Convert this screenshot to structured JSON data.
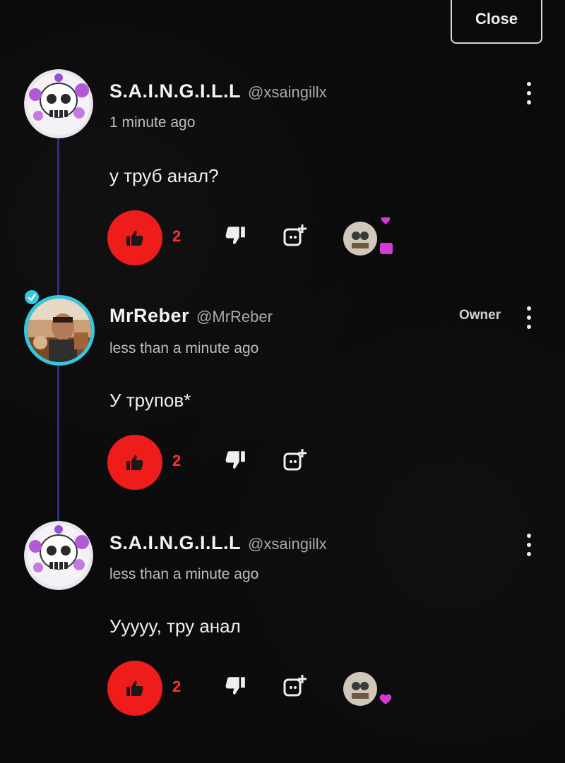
{
  "close_label": "Close",
  "owner_label": "Owner",
  "comments": [
    {
      "author": "S.A.I.N.G.I.L.L",
      "handle": "@xsaingillx",
      "time": "1 minute ago",
      "text": "у труб анал?",
      "likes": "2",
      "avatar_icon": "skull-avatar-icon",
      "has_creator_heart": true
    },
    {
      "author": "MrReber",
      "handle": "@MrReber",
      "time": "less than a minute ago",
      "text": "У трупов*",
      "likes": "2",
      "avatar_icon": "photo-avatar-icon",
      "is_owner": true,
      "has_creator_heart": false
    },
    {
      "author": "S.A.I.N.G.I.L.L",
      "handle": "@xsaingillx",
      "time": "less than a minute ago",
      "text": "Уyyyy, тру анал",
      "likes": "2",
      "avatar_icon": "skull-avatar-icon",
      "has_creator_heart": true
    }
  ],
  "colors": {
    "background": "#0b0b0b",
    "like_accent": "#ef1c1c",
    "heart_accent": "#d63ad6",
    "thread_line": "#2d2d8a",
    "owner_ring": "#35c7e0"
  }
}
